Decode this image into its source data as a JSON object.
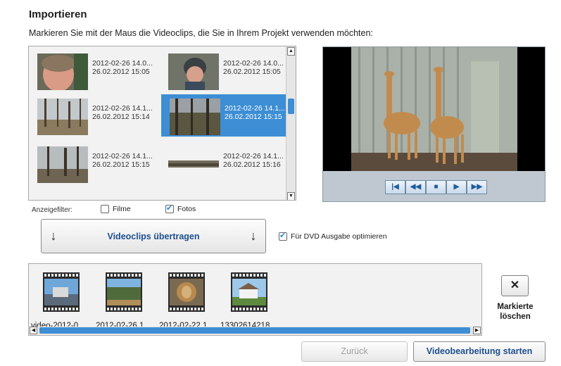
{
  "header": {
    "title": "Importieren",
    "instruction": "Markieren Sie mit der Maus die Videoclips, die Sie in Ihrem Projekt verwenden möchten:"
  },
  "browser": {
    "items": [
      {
        "line1": "2012-02-26 14.0...",
        "line2": "26.02.2012 15:05",
        "selected": false
      },
      {
        "line1": "2012-02-26 14.0...",
        "line2": "26.02.2012 15:05",
        "selected": false
      },
      {
        "line1": "2012-02-26 14.1...",
        "line2": "26.02.2012 15:14",
        "selected": false
      },
      {
        "line1": "2012-02-26 14.1...",
        "line2": "26.02.2012 15:15",
        "selected": true
      },
      {
        "line1": "2012-02-26 14.1...",
        "line2": "26.02.2012 15:15",
        "selected": false
      },
      {
        "line1": "2012-02-26 14.1...",
        "line2": "26.02.2012 15:16",
        "selected": false
      }
    ]
  },
  "filter": {
    "label": "Anzeigefilter:",
    "movies_label": "Filme",
    "movies_checked": false,
    "photos_label": "Fotos",
    "photos_checked": true
  },
  "transfer": {
    "label": "Videoclips übertragen"
  },
  "dvd": {
    "label": "Für DVD Ausgabe optimieren",
    "checked": true
  },
  "strip": {
    "clips": [
      {
        "label": "video-2012-0..."
      },
      {
        "label": "2012-02-26 1..."
      },
      {
        "label": "2012-02-22 1..."
      },
      {
        "label": "13302614218..."
      }
    ]
  },
  "delete": {
    "icon": "close-icon",
    "label_line1": "Markierte",
    "label_line2": "löschen"
  },
  "footer": {
    "back_label": "Zurück",
    "start_label": "Videobearbeitung starten"
  },
  "colors": {
    "accent": "#3d8ed4",
    "button_text": "#1d4e8f"
  }
}
